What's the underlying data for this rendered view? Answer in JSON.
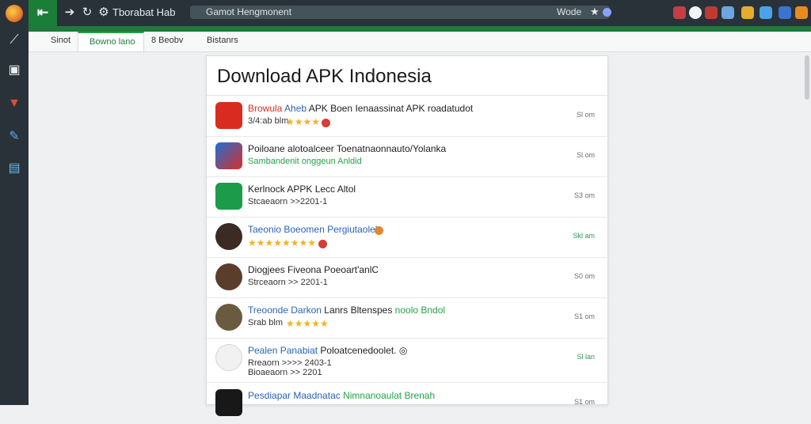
{
  "browser": {
    "title": "Tborabat Hab",
    "address": "Gamot Hengmonent",
    "address_right": "Wode"
  },
  "tabs": [
    "Sinot",
    "Bowno lano",
    "8 Beobv",
    "Bistanrs"
  ],
  "page": {
    "title": "Download APK Indonesia",
    "items": [
      {
        "name_a": "Browula",
        "name_b": "Aheb",
        "name_c": " APK Boen Ienaassinat APK roadatudot",
        "sub": "3/4:ab blm",
        "rating": "★★★★",
        "size": "Sl om"
      },
      {
        "name": "Poiloane alotoalceer Toenatnaonnauto/Yolanka",
        "sub_green": "Sambandenit onggeun Anldid",
        "size": "Sl om"
      },
      {
        "name": "Kerlnock APPK Lecc Altol",
        "sub": "Stcaeaorn >>2201-1",
        "size": "S3 om"
      },
      {
        "name_blue": "Taeonio Boeomen Pergiutaolek",
        "rating": "★★★★★★★★",
        "size": "Skl am"
      },
      {
        "name": "Diogjees Fiveona Poeoart'anlC",
        "sub": "Strceaorn >> 2201-1",
        "size": "S0 om"
      },
      {
        "name_blue": "Treoonde Darkon",
        "name_rest": " Lanrs Bltenspes",
        "name_green": " noolo Bndol",
        "sub": "Srab blm",
        "rating": "★★★★★",
        "size": "S1 om"
      },
      {
        "name_blue": "Pealen Panabiat",
        "name_rest": " Poloatcenedoolet. ◎",
        "sub": "Rreaorn >>>> 2403-1",
        "sub2": "Bioaeaorn >> 2201",
        "size": "Sl lan"
      },
      {
        "name_blue": "Pesdiapar Maadnatac",
        "name_green": " Nimnanoaulat Brenah",
        "size": "S1 om"
      }
    ]
  },
  "colors": {
    "accent": "#1b7e38",
    "link": "#2b63b6",
    "rating": "#f0b51c",
    "background": "#eef0f1"
  }
}
